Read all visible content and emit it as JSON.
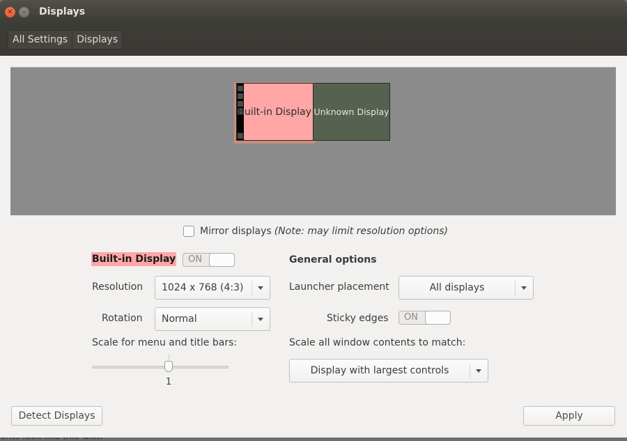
{
  "window": {
    "title": "Displays",
    "buttons": {
      "close_icon": "✕",
      "minimize_icon": "–"
    }
  },
  "breadcrumb": [
    {
      "label": "All Settings"
    },
    {
      "label": "Displays"
    }
  ],
  "arrangement": {
    "monitors": [
      {
        "label": "Built-in Display",
        "color": "#ffa6a6",
        "selected": true
      },
      {
        "label": "Unknown Display",
        "color": "#56614f",
        "selected": false
      }
    ]
  },
  "mirror": {
    "label": "Mirror displays",
    "note": "(Note: may limit resolution options)",
    "checked": false
  },
  "builtin": {
    "header": "Built-in Display",
    "power_toggle": {
      "state_label": "ON",
      "on": true
    },
    "resolution": {
      "label": "Resolution",
      "value": "1024 x 768 (4:3)"
    },
    "rotation": {
      "label": "Rotation",
      "value": "Normal"
    },
    "scale": {
      "label": "Scale for menu and title bars:",
      "value": "1"
    }
  },
  "general": {
    "header": "General options",
    "launcher": {
      "label": "Launcher placement",
      "value": "All displays"
    },
    "sticky_edges": {
      "label": "Sticky edges",
      "state_label": "ON",
      "on": true
    },
    "scale_contents": {
      "label": "Scale all window contents to match:",
      "value": "Display with largest controls"
    }
  },
  "footer": {
    "detect_label": "Detect Displays",
    "apply_label": "Apply"
  },
  "background_text": "ents look like this Gist."
}
